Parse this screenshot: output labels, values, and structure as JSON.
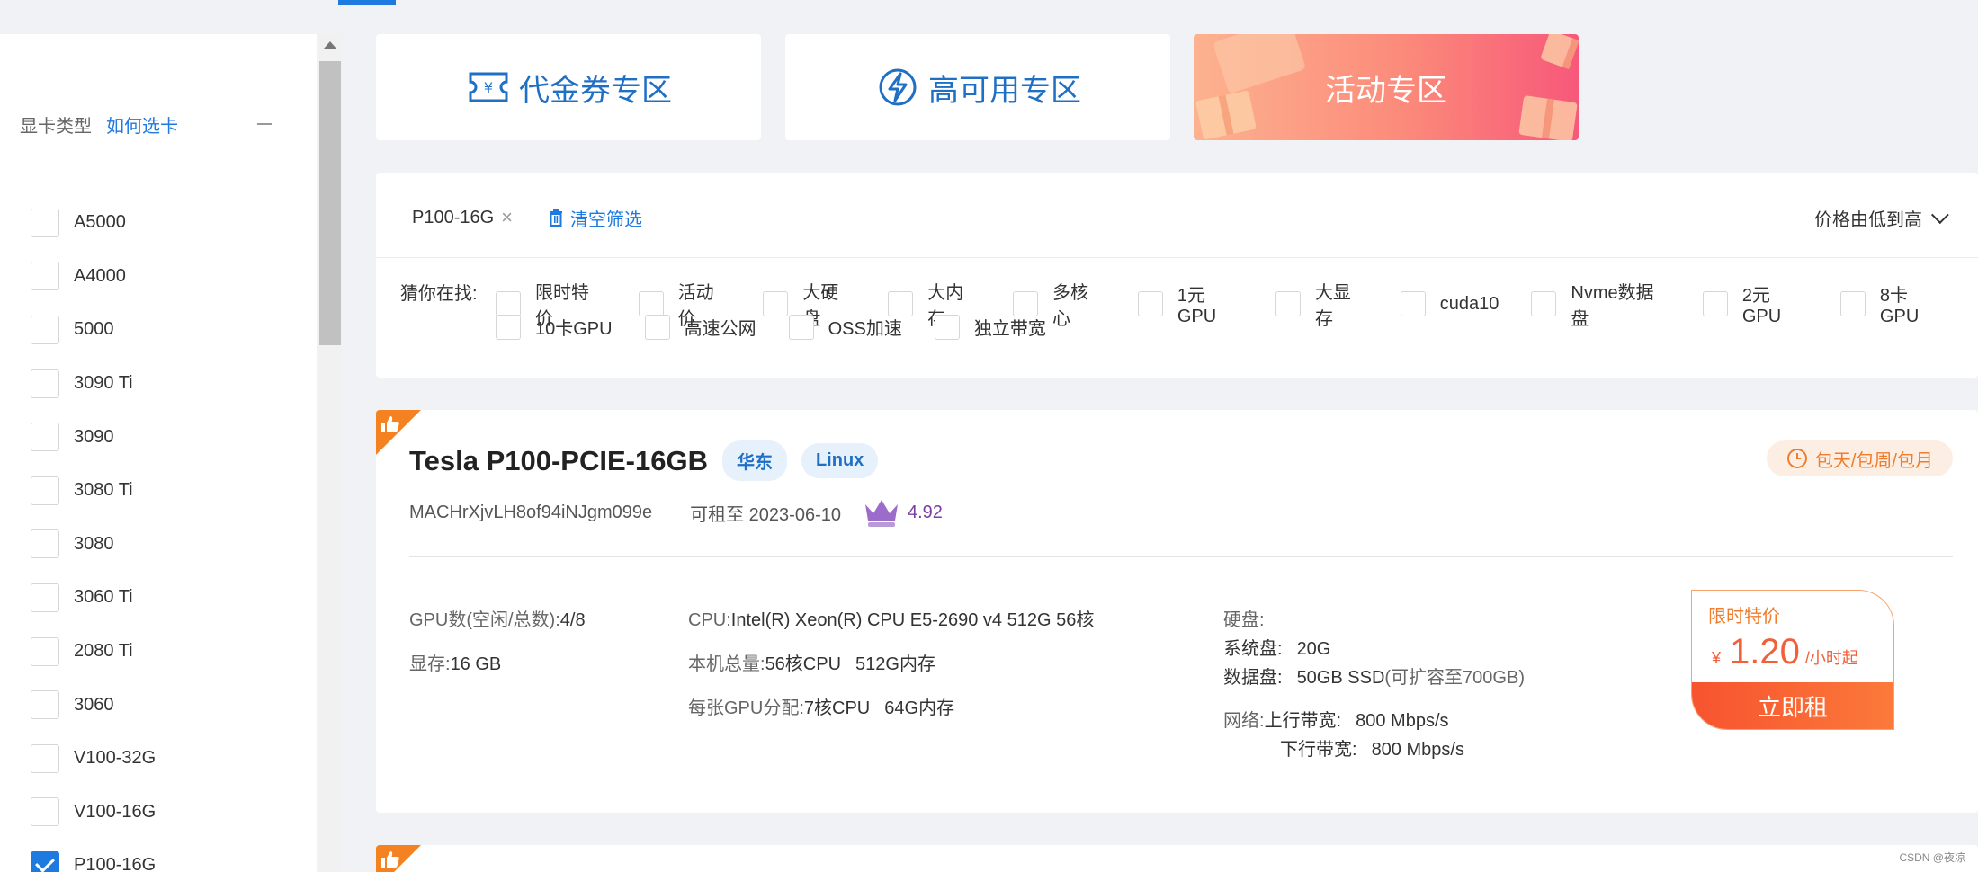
{
  "sidebar": {
    "filter_title": "显卡类型",
    "filter_help": "如何选卡",
    "gpu_types": [
      {
        "label": "A5000",
        "checked": false
      },
      {
        "label": "A4000",
        "checked": false
      },
      {
        "label": "5000",
        "checked": false
      },
      {
        "label": "3090 Ti",
        "checked": false
      },
      {
        "label": "3090",
        "checked": false
      },
      {
        "label": "3080 Ti",
        "checked": false
      },
      {
        "label": "3080",
        "checked": false
      },
      {
        "label": "3060 Ti",
        "checked": false
      },
      {
        "label": "2080 Ti",
        "checked": false
      },
      {
        "label": "3060",
        "checked": false
      },
      {
        "label": "V100-32G",
        "checked": false
      },
      {
        "label": "V100-16G",
        "checked": false
      },
      {
        "label": "P100-16G",
        "checked": true
      }
    ]
  },
  "banners": {
    "voucher": "代金券专区",
    "high_availability": "高可用专区",
    "activity": "活动专区",
    "voucher_icon_symbol": "¥"
  },
  "filters": {
    "active_tag": "P100-16G",
    "clear_label": "清空筛选",
    "sort_label": "价格由低到高",
    "guess_label": "猜你在找:",
    "guess_row_1": [
      "限时特价",
      "活动价",
      "大硬盘",
      "大内存",
      "多核心",
      "1元GPU",
      "大显存",
      "cuda10",
      "Nvme数据盘",
      "2元GPU",
      "8卡GPU"
    ],
    "guess_row_2": [
      "10卡GPU",
      "高速公网",
      "OSS加速",
      "独立带宽"
    ]
  },
  "product": {
    "name": "Tesla P100-PCIE-16GB",
    "region": "华东",
    "os": "Linux",
    "rent_mode": "包天/包周/包月",
    "machine_id": "MACHrXjvLH8of94iNJgm099e",
    "available_until": "可租至 2023-06-10",
    "rating": "4.92",
    "gpu_count_label": "GPU数(空闲/总数):",
    "gpu_count_value": "4/8",
    "vram_label": "显存:",
    "vram_value": "16 GB",
    "cpu_label": "CPU:",
    "cpu_value": "Intel(R) Xeon(R) CPU E5-2690 v4 512G 56核",
    "total_label": "本机总量:",
    "total_cpu": "56核CPU",
    "total_mem": "512G内存",
    "per_gpu_label": "每张GPU分配:",
    "per_gpu_cpu": "7核CPU",
    "per_gpu_mem": "64G内存",
    "disk_label": "硬盘:",
    "system_disk_label": "系统盘:",
    "system_disk_value": "20G",
    "data_disk_label": "数据盘:",
    "data_disk_value": "50GB SSD",
    "data_disk_note": "(可扩容至700GB)",
    "network_label": "网络:",
    "upload_label": "上行带宽:",
    "upload_value": "800 Mbps/s",
    "download_label": "下行带宽:",
    "download_value": "800 Mbps/s",
    "price_label": "限时特价",
    "price_currency": "¥",
    "price_value": "1.20",
    "price_unit": "/小时起",
    "rent_button": "立即租"
  },
  "watermark": "CSDN @夜凉",
  "colors": {
    "accent": "#1f7ae0",
    "price": "#f2603a",
    "badge_orange": "#f58220"
  }
}
